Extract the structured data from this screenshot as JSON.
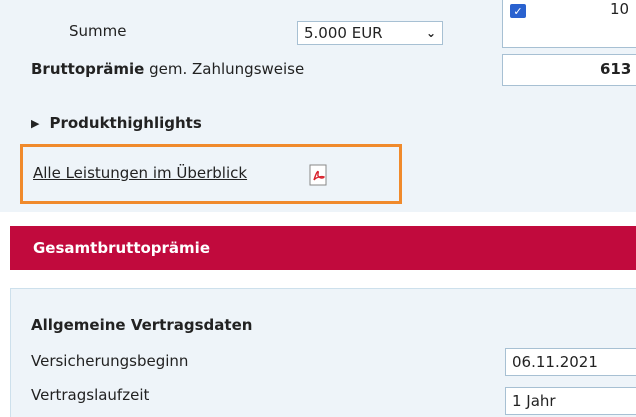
{
  "summe": {
    "label": "Summe",
    "select_value": "5.000 EUR"
  },
  "top_right": {
    "partial_number": "10"
  },
  "brutto": {
    "label_bold": "Bruttoprämie",
    "label_rest": " gem. Zahlungsweise",
    "value": "613"
  },
  "highlights": {
    "label": "Produkthighlights"
  },
  "link": {
    "text": "Alle Leistungen im Überblick"
  },
  "header_bar": {
    "title": "Gesamtbruttoprämie"
  },
  "contract": {
    "title": "Allgemeine Vertragsdaten",
    "rows": [
      {
        "label": "Versicherungsbeginn",
        "value": "06.11.2021"
      },
      {
        "label": "Vertragslaufzeit",
        "value": "1 Jahr"
      }
    ]
  },
  "colors": {
    "accent_red": "#c10a3d",
    "highlight_orange": "#f08a2c",
    "checkbox_blue": "#2a62cf",
    "panel_bg": "#eef4f9"
  }
}
